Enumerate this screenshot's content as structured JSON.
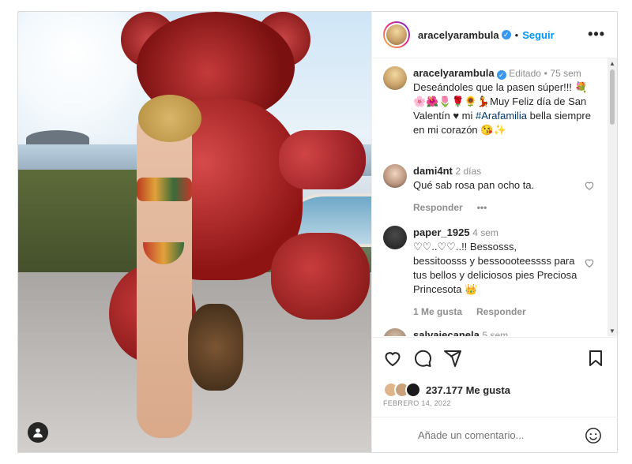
{
  "post": {
    "username": "aracelyarambula",
    "follow_label": "Seguir",
    "more_label": "•••",
    "dot": "•"
  },
  "caption": {
    "username": "aracelyarambula",
    "edited": "Editado",
    "dot": "•",
    "time": "75 sem",
    "text_line1": "Deseándoles que la pasen súper!!! 💐",
    "text_line2": "🌸🌺🌷🌹🌻💃Muy Feliz día de San",
    "text_line3_pre": "Valentín ♥ mi ",
    "hashtag": "#Arafamilia",
    "text_line3_post": " bella siempre",
    "text_line4": "en mi corazón 😘✨"
  },
  "comments": [
    {
      "username": "dami4nt",
      "time": "2 días",
      "text": "Qué sab rosa pan ocho ta.",
      "reply": "Responder",
      "options": "•••"
    },
    {
      "username": "paper_1925",
      "time": "4 sem",
      "text_l1": "♡♡..♡♡..!! Bessosss,",
      "text_l2": "bessitoosss y bessoooteessss para",
      "text_l3": "tus bellos y deliciosos pies Preciosa",
      "text_l4": "Princesota 👑",
      "likes": "1 Me gusta",
      "reply": "Responder"
    },
    {
      "username": "salvajecanela",
      "time": "5 sem"
    }
  ],
  "actions": {
    "likes": "237.177 Me gusta",
    "date": "FEBRERO 14, 2022"
  },
  "add_comment": {
    "placeholder": "Añade un comentario..."
  },
  "colors": {
    "link": "#0095f6",
    "verified": "#3897f0",
    "muted": "#8e8e8e"
  }
}
